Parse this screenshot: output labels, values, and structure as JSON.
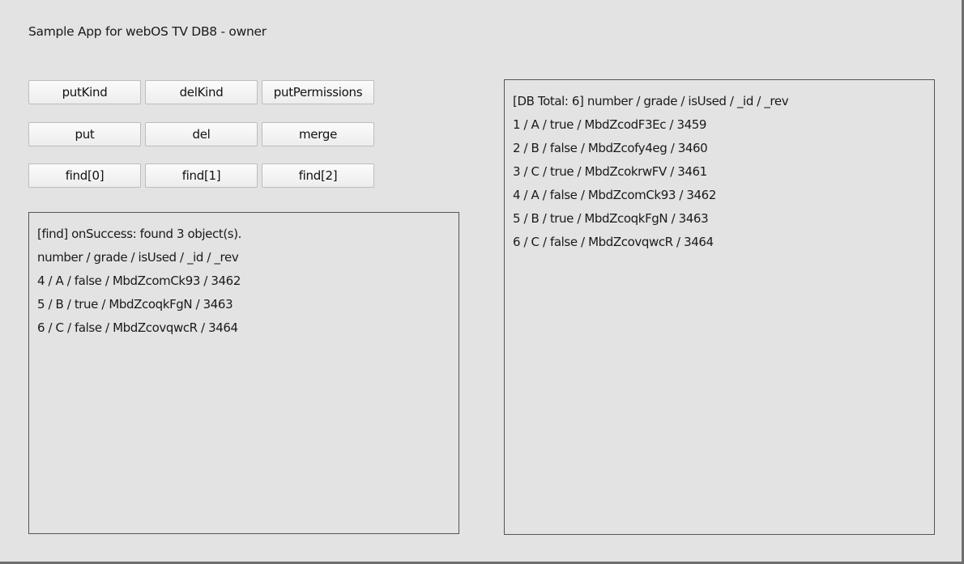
{
  "app": {
    "title": "Sample App for webOS TV DB8 - owner"
  },
  "buttons": {
    "row1": [
      "putKind",
      "delKind",
      "putPermissions"
    ],
    "row2": [
      "put",
      "del",
      "merge"
    ],
    "row3": [
      "find[0]",
      "find[1]",
      "find[2]"
    ]
  },
  "find_result": {
    "lines": [
      "[find] onSuccess: found 3 object(s).",
      "number / grade / isUsed / _id / _rev",
      "4 / A / false / MbdZcomCk93 / 3462",
      "5 / B / true / MbdZcoqkFgN / 3463",
      "6 / C / false / MbdZcovqwcR / 3464"
    ]
  },
  "db_list": {
    "lines": [
      "[DB Total: 6] number / grade / isUsed / _id / _rev",
      "1 / A / true / MbdZcodF3Ec / 3459",
      "2 / B / false / MbdZcofy4eg / 3460",
      "3 / C / true / MbdZcokrwFV / 3461",
      "4 / A / false / MbdZcomCk93 / 3462",
      "5 / B / true / MbdZcoqkFgN / 3463",
      "6 / C / false / MbdZcovqwcR / 3464"
    ]
  }
}
